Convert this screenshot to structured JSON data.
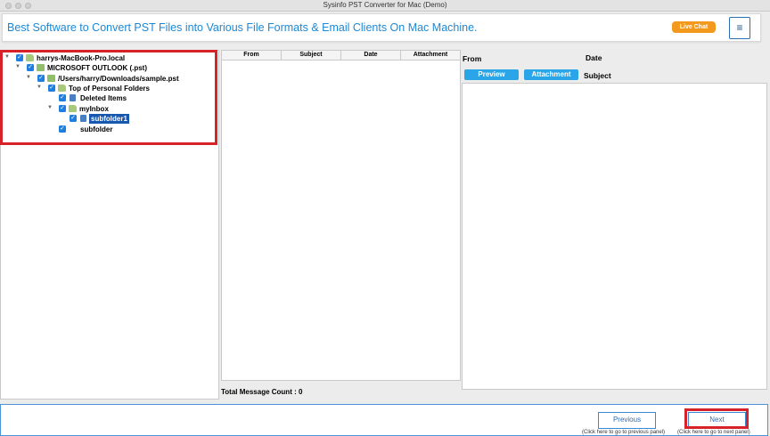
{
  "window": {
    "title": "Sysinfo PST Converter for Mac (Demo)"
  },
  "banner": {
    "headline": "Best Software to Convert PST Files into Various File Formats & Email Clients On Mac Machine.",
    "live_chat": "Live Chat",
    "menu_glyph": "≡"
  },
  "tree": {
    "nodes": [
      {
        "label": "harrys-MacBook-Pro.local",
        "icon": "computer-icon",
        "expanded": true,
        "checked": true
      },
      {
        "label": "MICROSOFT OUTLOOK (.pst)",
        "icon": "outlook-icon",
        "expanded": true,
        "checked": true
      },
      {
        "label": "/Users/harry/Downloads/sample.pst",
        "icon": "pst-file-icon",
        "expanded": true,
        "checked": true
      },
      {
        "label": "Top of Personal Folders",
        "icon": "folder-icon",
        "expanded": true,
        "checked": true
      },
      {
        "label": "Deleted Items",
        "icon": "folder-icon",
        "checked": true
      },
      {
        "label": "myInbox",
        "icon": "folder-icon",
        "expanded": true,
        "checked": true
      },
      {
        "label": "subfolder1",
        "icon": "folder-icon",
        "checked": true,
        "selected": true
      },
      {
        "label": "subfolder",
        "icon": "",
        "checked": true
      }
    ]
  },
  "message_list": {
    "columns": [
      "From",
      "Subject",
      "Date",
      "Attachment"
    ],
    "count_label": "Total Message Count : 0"
  },
  "preview": {
    "from_label": "From",
    "date_label": "Date",
    "subject_label": "Subject",
    "preview_button": "Preview",
    "attachment_button": "Attachment"
  },
  "footer": {
    "previous_label": "Previous",
    "previous_hint": "(Click here to go to previous panel)",
    "next_label": "Next",
    "next_hint": "(Click here to go to next panel)"
  },
  "colors": {
    "accent": "#1e88d4",
    "live_chat": "#f39a1e",
    "highlight": "#d8222a",
    "selection": "#1757b0",
    "checkbox": "#1f7fe0"
  }
}
